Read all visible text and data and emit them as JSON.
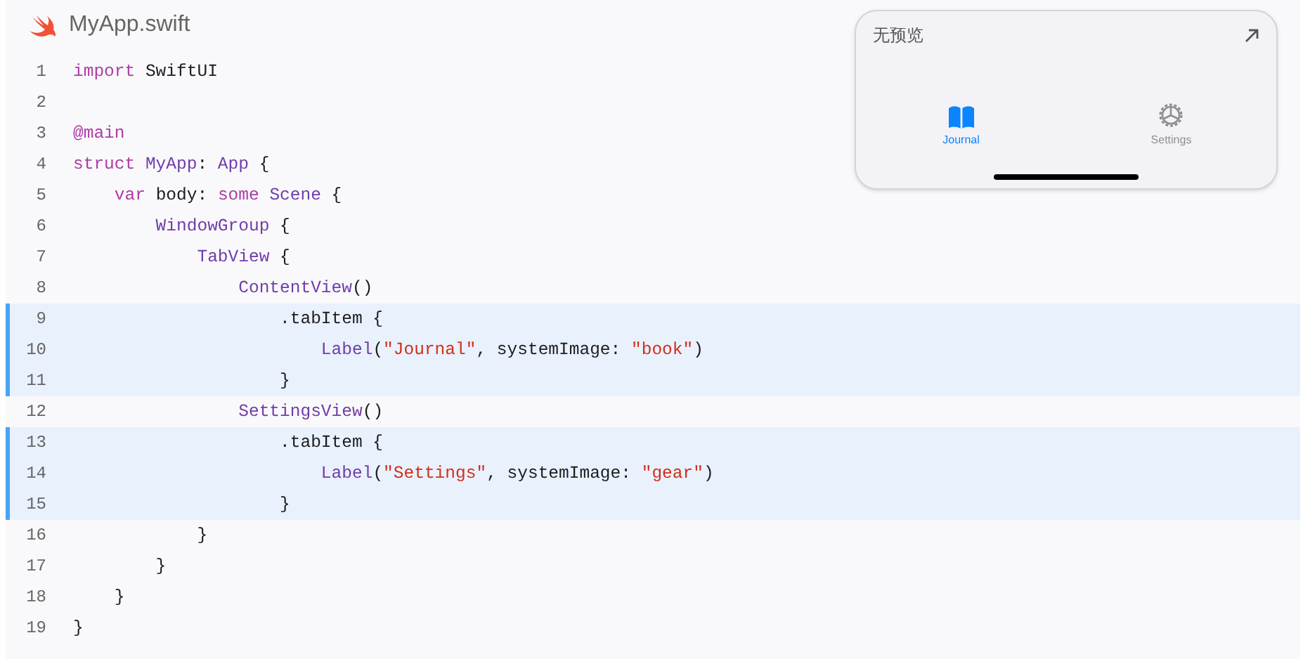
{
  "file": {
    "name": "MyApp.swift"
  },
  "code": [
    {
      "number": "1",
      "highlighted": false,
      "tokens": [
        {
          "kind": "keyword",
          "text": "import"
        },
        {
          "kind": "plain",
          "text": " SwiftUI"
        }
      ]
    },
    {
      "number": "2",
      "highlighted": false
    },
    {
      "number": "3",
      "highlighted": false,
      "tokens": [
        {
          "kind": "keyword",
          "text": "@main"
        }
      ]
    },
    {
      "number": "4",
      "highlighted": false,
      "tokens": [
        {
          "kind": "keyword",
          "text": "struct"
        },
        {
          "kind": "type",
          "text": " MyApp"
        },
        {
          "kind": "plain",
          "text": ": "
        },
        {
          "kind": "type",
          "text": "App"
        },
        {
          "kind": "plain",
          "text": " {"
        }
      ]
    },
    {
      "number": "5",
      "highlighted": false,
      "tokens": [
        {
          "kind": "keyword",
          "text": "    var"
        },
        {
          "kind": "plain",
          "text": " body: "
        },
        {
          "kind": "keyword",
          "text": "some"
        },
        {
          "kind": "type",
          "text": " Scene"
        },
        {
          "kind": "plain",
          "text": " {"
        }
      ]
    },
    {
      "number": "6",
      "highlighted": false,
      "tokens": [
        {
          "kind": "type",
          "text": "        WindowGroup"
        },
        {
          "kind": "plain",
          "text": " {"
        }
      ]
    },
    {
      "number": "7",
      "highlighted": false,
      "tokens": [
        {
          "kind": "type",
          "text": "            TabView"
        },
        {
          "kind": "plain",
          "text": " {"
        }
      ]
    },
    {
      "number": "8",
      "highlighted": false,
      "tokens": [
        {
          "kind": "type",
          "text": "                ContentView"
        },
        {
          "kind": "plain",
          "text": "()"
        }
      ]
    },
    {
      "number": "9",
      "highlighted": true,
      "tokens": [
        {
          "kind": "plain",
          "text": "                    .tabItem {"
        }
      ]
    },
    {
      "number": "10",
      "highlighted": true,
      "tokens": [
        {
          "kind": "type",
          "text": "                        Label"
        },
        {
          "kind": "plain",
          "text": "("
        },
        {
          "kind": "string",
          "text": "\"Journal\""
        },
        {
          "kind": "plain",
          "text": ", systemImage: "
        },
        {
          "kind": "string",
          "text": "\"book\""
        },
        {
          "kind": "plain",
          "text": ")"
        }
      ]
    },
    {
      "number": "11",
      "highlighted": true,
      "tokens": [
        {
          "kind": "plain",
          "text": "                    }"
        }
      ]
    },
    {
      "number": "12",
      "highlighted": false,
      "tokens": [
        {
          "kind": "type",
          "text": "                SettingsView"
        },
        {
          "kind": "plain",
          "text": "()"
        }
      ]
    },
    {
      "number": "13",
      "highlighted": true,
      "tokens": [
        {
          "kind": "plain",
          "text": "                    .tabItem {"
        }
      ]
    },
    {
      "number": "14",
      "highlighted": true,
      "tokens": [
        {
          "kind": "type",
          "text": "                        Label"
        },
        {
          "kind": "plain",
          "text": "("
        },
        {
          "kind": "string",
          "text": "\"Settings\""
        },
        {
          "kind": "plain",
          "text": ", systemImage: "
        },
        {
          "kind": "string",
          "text": "\"gear\""
        },
        {
          "kind": "plain",
          "text": ")"
        }
      ]
    },
    {
      "number": "15",
      "highlighted": true,
      "tokens": [
        {
          "kind": "plain",
          "text": "                    }"
        }
      ]
    },
    {
      "number": "16",
      "highlighted": false,
      "tokens": [
        {
          "kind": "plain",
          "text": "            }"
        }
      ]
    },
    {
      "number": "17",
      "highlighted": false,
      "tokens": [
        {
          "kind": "plain",
          "text": "        }"
        }
      ]
    },
    {
      "number": "18",
      "highlighted": false,
      "tokens": [
        {
          "kind": "plain",
          "text": "    }"
        }
      ]
    },
    {
      "number": "19",
      "highlighted": false,
      "tokens": [
        {
          "kind": "plain",
          "text": "}"
        }
      ]
    }
  ],
  "preview": {
    "title": "无预览",
    "tabs": [
      {
        "label": "Journal",
        "kind": "book",
        "selected": true
      },
      {
        "label": "Settings",
        "kind": "gear",
        "selected": false
      }
    ]
  }
}
